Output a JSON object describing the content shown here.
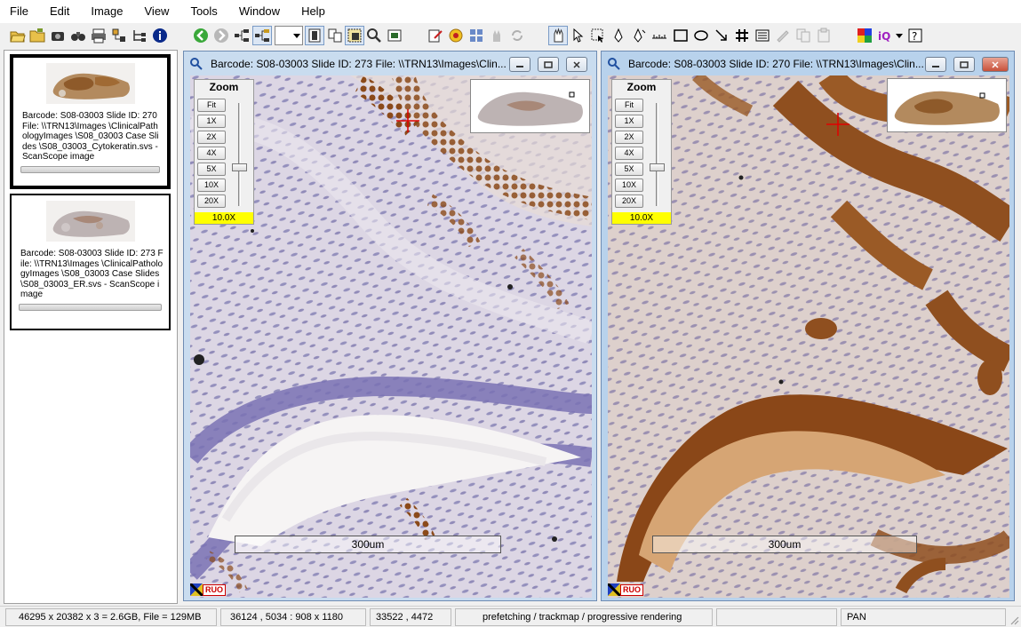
{
  "menubar": {
    "items": [
      "File",
      "Edit",
      "Image",
      "View",
      "Tools",
      "Window",
      "Help"
    ]
  },
  "toolbar": {
    "icons": [
      "open-folder-icon",
      "folder-icon",
      "camera-icon",
      "binoculars-icon",
      "print-icon",
      "network-icon",
      "tree-icon",
      "info-icon",
      "back-icon",
      "forward-icon",
      "hierarchy-icon",
      "hierarchy-active-icon",
      "view-dropdown",
      "window-icon",
      "image-list-icon",
      "selection-icon",
      "zoom-icon",
      "slide-icon",
      "edit-icon",
      "badge-icon",
      "grid-icon",
      "hand-icon",
      "sync-icon",
      "pan-icon",
      "pointer-icon",
      "select-icon",
      "pen-icon",
      "magic-pen-icon",
      "ruler-icon",
      "rectangle-icon",
      "ellipse-icon",
      "arrow-icon",
      "hash-icon",
      "list-icon",
      "disabled1-icon",
      "copy-icon",
      "paste-icon",
      "color-icon",
      "iq-icon",
      "help-icon"
    ]
  },
  "thumbnails": [
    {
      "text": "Barcode: S08-03003   Slide ID: 270  File: \\\\TRN13\\Images \\ClinicalPathologyImages \\S08_03003 Case Slides \\S08_03003_Cytokeratin.svs - ScanScope image",
      "selected": true
    },
    {
      "text": "Barcode: S08-03003   Slide ID: 273  File: \\\\TRN13\\Images \\ClinicalPathologyImages \\S08_03003 Case Slides \\S08_03003_ER.svs - ScanScope image",
      "selected": false
    }
  ],
  "windows": [
    {
      "title": "Barcode: S08-03003   Slide ID: 273   File: \\\\TRN13\\Images\\Clin...",
      "zoom": {
        "title": "Zoom",
        "buttons": [
          "Fit",
          "1X",
          "2X",
          "4X",
          "5X",
          "10X",
          "20X"
        ],
        "level": "10.0X"
      },
      "scalebar": "300um",
      "ruo": "RUO",
      "stain": "ER"
    },
    {
      "title": "Barcode: S08-03003   Slide ID: 270   File: \\\\TRN13\\Images\\Clin...",
      "zoom": {
        "title": "Zoom",
        "buttons": [
          "Fit",
          "1X",
          "2X",
          "4X",
          "5X",
          "10X",
          "20X"
        ],
        "level": "10.0X"
      },
      "scalebar": "300um",
      "ruo": "RUO",
      "stain": "Cytokeratin"
    }
  ],
  "statusbar": {
    "cells": [
      "46295 x 20382 x 3 = 2.6GB, File = 129MB",
      "36124 , 5034 : 908 x 1180",
      "33522 , 4472",
      "prefetching / trackmap / progressive rendering",
      "",
      "PAN"
    ]
  },
  "colors": {
    "hematoxylin": "#8a86b8",
    "dab_brown": "#8b4a1a",
    "crosshair": "#e00000",
    "zoom_level_bg": "#ffff00"
  }
}
